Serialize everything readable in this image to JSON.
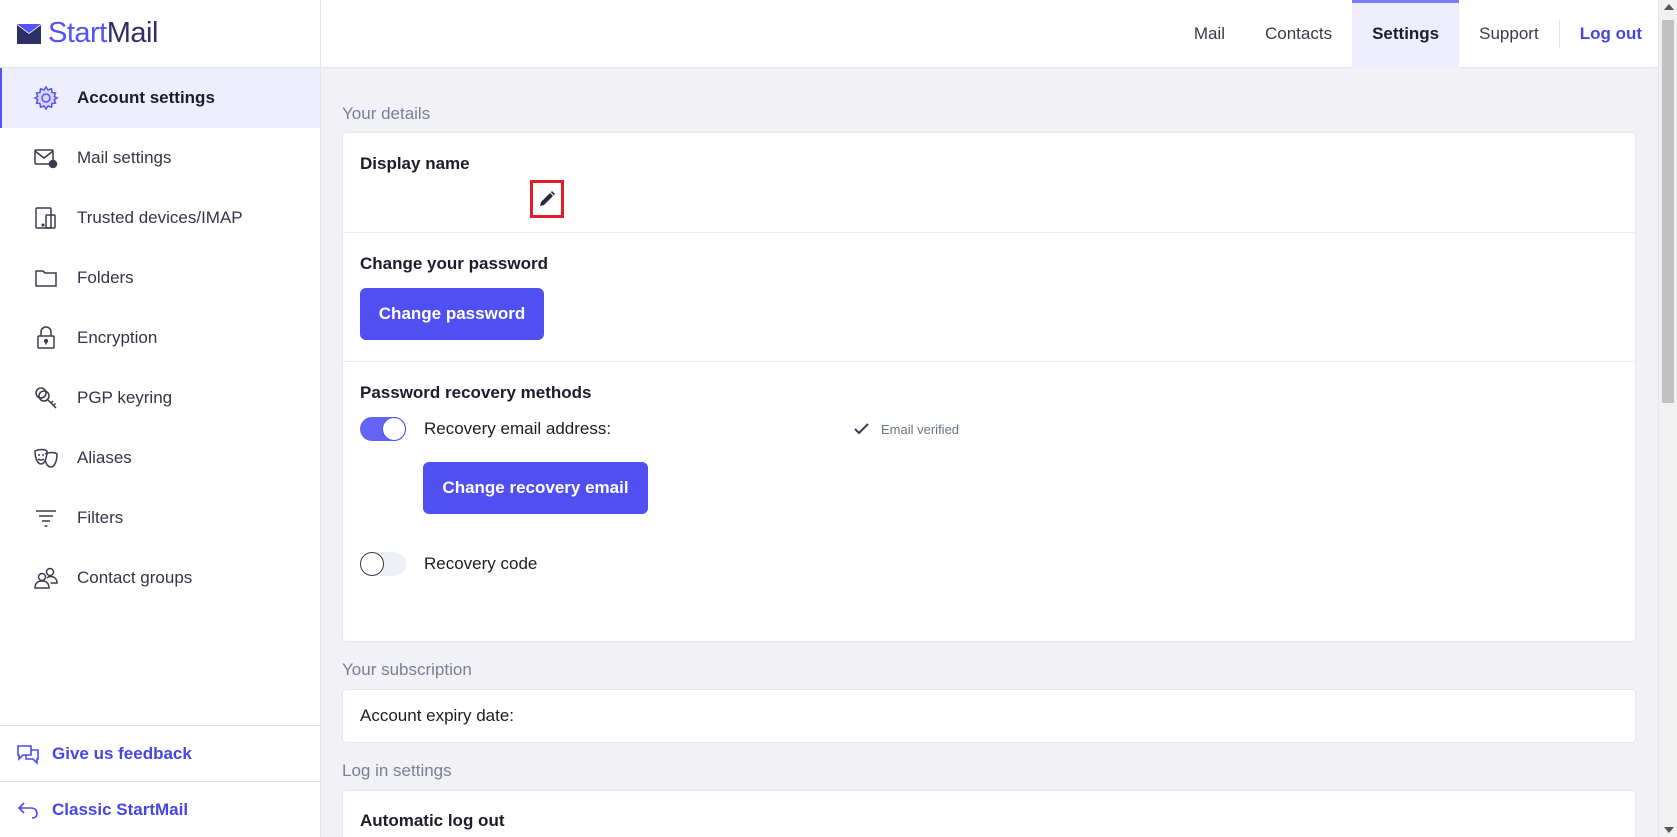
{
  "brand": {
    "start": "Start",
    "mail": "Mail"
  },
  "sidebar": {
    "items": [
      {
        "label": "Account settings",
        "icon": "gear-icon",
        "active": true
      },
      {
        "label": "Mail settings",
        "icon": "mail-settings-icon"
      },
      {
        "label": "Trusted devices/IMAP",
        "icon": "devices-icon"
      },
      {
        "label": "Folders",
        "icon": "folder-icon"
      },
      {
        "label": "Encryption",
        "icon": "lock-icon"
      },
      {
        "label": "PGP keyring",
        "icon": "key-icon"
      },
      {
        "label": "Aliases",
        "icon": "masks-icon"
      },
      {
        "label": "Filters",
        "icon": "filter-icon"
      },
      {
        "label": "Contact groups",
        "icon": "contact-groups-icon"
      }
    ],
    "feedback_label": "Give us feedback",
    "classic_label": "Classic StartMail"
  },
  "topnav": {
    "mail": "Mail",
    "contacts": "Contacts",
    "settings": "Settings",
    "support": "Support",
    "logout": "Log out"
  },
  "details": {
    "section_title": "Your details",
    "display_name_label": "Display name",
    "change_password_heading": "Change your password",
    "change_password_button": "Change password",
    "recovery_heading": "Password recovery methods",
    "recovery_email_label": "Recovery email address:",
    "email_verified": "Email verified",
    "change_recovery_button": "Change recovery email",
    "recovery_code_label": "Recovery code",
    "recovery_email_enabled": true,
    "recovery_code_enabled": false
  },
  "subscription": {
    "section_title": "Your subscription",
    "expiry_label": "Account expiry date:"
  },
  "login_settings": {
    "section_title": "Log in settings",
    "auto_logout_heading": "Automatic log out"
  },
  "colors": {
    "accent": "#4f4ff2",
    "highlight_box": "#e11d2b"
  }
}
